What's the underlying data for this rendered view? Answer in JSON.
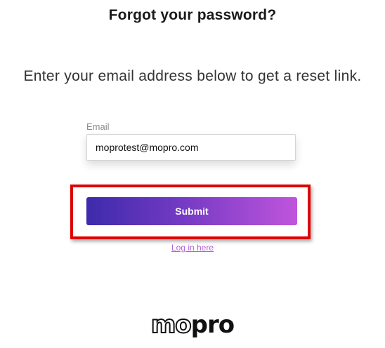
{
  "page": {
    "title": "Forgot your password?",
    "subtitle": "Enter your email address below to get a reset link."
  },
  "form": {
    "email_label": "Email",
    "email_value": "moprotest@mopro.com",
    "submit_label": "Submit",
    "login_link": "Log in here"
  },
  "logo": {
    "part1": "mo",
    "part2": "pro"
  },
  "colors": {
    "gradient_start": "#3d2aab",
    "gradient_end": "#c055dc",
    "link": "#b560d8",
    "highlight": "#e00000"
  }
}
